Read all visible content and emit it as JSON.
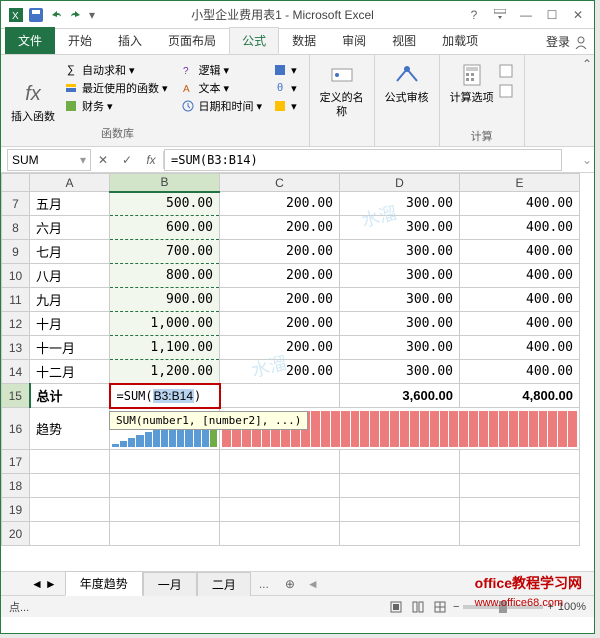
{
  "title": "小型企业费用表1 - Microsoft Excel",
  "tabs": {
    "file": "文件",
    "home": "开始",
    "insert": "插入",
    "layout": "页面布局",
    "formulas": "公式",
    "data": "数据",
    "review": "审阅",
    "view": "视图",
    "addins": "加载项",
    "login": "登录"
  },
  "ribbon": {
    "insert_fn": "插入函数",
    "autosum": "自动求和",
    "recent": "最近使用的函数",
    "financial": "财务",
    "logical": "逻辑",
    "text": "文本",
    "datetime": "日期和时间",
    "library_label": "函数库",
    "defined_names": "定义的名称",
    "formula_auditing": "公式审核",
    "calc_options": "计算选项",
    "calc_label": "计算"
  },
  "name_box": "SUM",
  "formula": "=SUM(B3:B14)",
  "formula_display": {
    "prefix": "=SUM(",
    "range": "B3:B14",
    "suffix": ")"
  },
  "tooltip": "SUM(number1, [number2], ...)",
  "columns": [
    "A",
    "B",
    "C",
    "D",
    "E"
  ],
  "rows": [
    {
      "n": 7,
      "label": "五月",
      "b": "500.00",
      "c": "200.00",
      "d": "300.00",
      "e": "400.00"
    },
    {
      "n": 8,
      "label": "六月",
      "b": "600.00",
      "c": "200.00",
      "d": "300.00",
      "e": "400.00"
    },
    {
      "n": 9,
      "label": "七月",
      "b": "700.00",
      "c": "200.00",
      "d": "300.00",
      "e": "400.00"
    },
    {
      "n": 10,
      "label": "八月",
      "b": "800.00",
      "c": "200.00",
      "d": "300.00",
      "e": "400.00"
    },
    {
      "n": 11,
      "label": "九月",
      "b": "900.00",
      "c": "200.00",
      "d": "300.00",
      "e": "400.00"
    },
    {
      "n": 12,
      "label": "十月",
      "b": "1,000.00",
      "c": "200.00",
      "d": "300.00",
      "e": "400.00"
    },
    {
      "n": 13,
      "label": "十一月",
      "b": "1,100.00",
      "c": "200.00",
      "d": "300.00",
      "e": "400.00"
    },
    {
      "n": 14,
      "label": "十二月",
      "b": "1,200.00",
      "c": "200.00",
      "d": "300.00",
      "e": "400.00"
    }
  ],
  "total_row": {
    "n": 15,
    "label": "总计",
    "d": "3,600.00",
    "e": "4,800.00",
    "f_partial": "6"
  },
  "trend_row": {
    "n": 16,
    "label": "趋势"
  },
  "empty_rows": [
    17,
    18,
    19,
    20
  ],
  "sheet_tabs": {
    "active": "年度趋势",
    "t1": "一月",
    "t2": "二月"
  },
  "status": "点...",
  "zoom": "100%",
  "footer": {
    "text": "office教程学习网",
    "url": "www.office68.com"
  },
  "chart_data": {
    "type": "bar",
    "note": "Sparkline columns per expense column; B increases 100→1200, C constant 200, D constant 300, E constant 400",
    "series": [
      {
        "name": "B",
        "values": [
          100,
          200,
          300,
          400,
          500,
          600,
          700,
          800,
          900,
          1000,
          1100,
          1200
        ],
        "color": "#5b9bd5"
      },
      {
        "name": "C",
        "values": [
          200,
          200,
          200,
          200,
          200,
          200,
          200,
          200,
          200,
          200,
          200,
          200
        ],
        "color": "#ed7d7d"
      },
      {
        "name": "D",
        "values": [
          300,
          300,
          300,
          300,
          300,
          300,
          300,
          300,
          300,
          300,
          300,
          300
        ],
        "color": "#ed7d7d"
      },
      {
        "name": "E",
        "values": [
          400,
          400,
          400,
          400,
          400,
          400,
          400,
          400,
          400,
          400,
          400,
          400
        ],
        "color": "#ed7d7d"
      }
    ]
  }
}
